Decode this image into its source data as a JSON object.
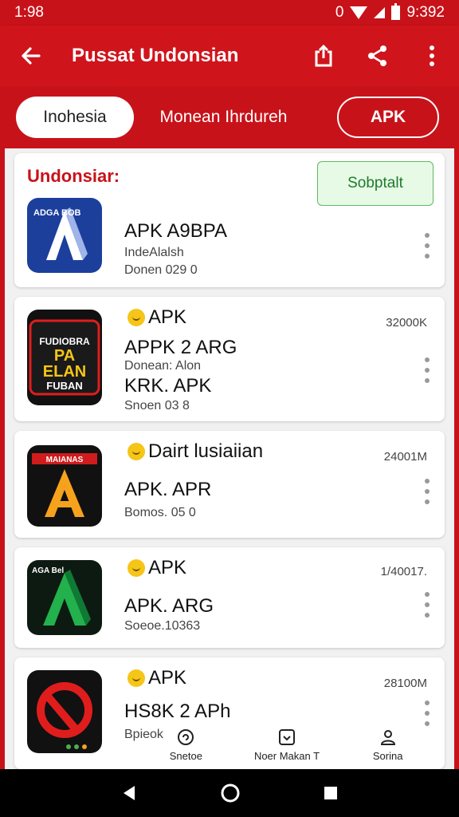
{
  "status_bar": {
    "time": "1:98",
    "right_text": "0",
    "battery_text": "9:392"
  },
  "app_bar": {
    "title": "Pussat Undonsian"
  },
  "tabs": [
    {
      "label": "Inohesia",
      "selected": true
    },
    {
      "label": "Monean Ihrdureh",
      "selected": false
    },
    {
      "label": "APK",
      "selected": false
    }
  ],
  "section": {
    "title": "Undonsiar:",
    "button_label": "Sobptalt"
  },
  "apps": [
    {
      "name": "APK A9BPA",
      "line1": "IndeAlalsh",
      "line2": "Donen 029 0",
      "icon_text": "ADGA BOB",
      "icon_letter": "A"
    },
    {
      "tag": "APK",
      "size": "32000K",
      "name": "APPK 2 ARG",
      "line1": "Donean: Alon",
      "name2": "KRK. APK",
      "line2": "Snoen 03 8",
      "icon_text1": "FUDIOBRA",
      "icon_text2": "PA",
      "icon_text3": "ELAN",
      "icon_text4": "FUBAN"
    },
    {
      "tag": "Dairt lusiaiian",
      "size": "24001M",
      "name": "APK. APR",
      "line1": "Bomos. 05 0",
      "icon_text": "MAIANAS",
      "icon_letter": "A"
    },
    {
      "tag": "APK",
      "size": "1/40017.",
      "name": "APK. ARG",
      "line1": "Soeoe.10363",
      "icon_text": "AGA Bel"
    },
    {
      "tag": "APK",
      "size": "28100M",
      "name": "HS8K 2 APh",
      "line1": "Bpieok"
    }
  ],
  "bottom_nav": [
    {
      "label": "Snetoe",
      "icon": "refresh-icon"
    },
    {
      "label": "Noer Makan T",
      "icon": "download-box-icon"
    },
    {
      "label": "Sorina",
      "icon": "person-icon"
    }
  ],
  "colors": {
    "primary": "#c8121a",
    "green_button_bg": "#e6fae6",
    "green_button_text": "#1f7a2a"
  }
}
